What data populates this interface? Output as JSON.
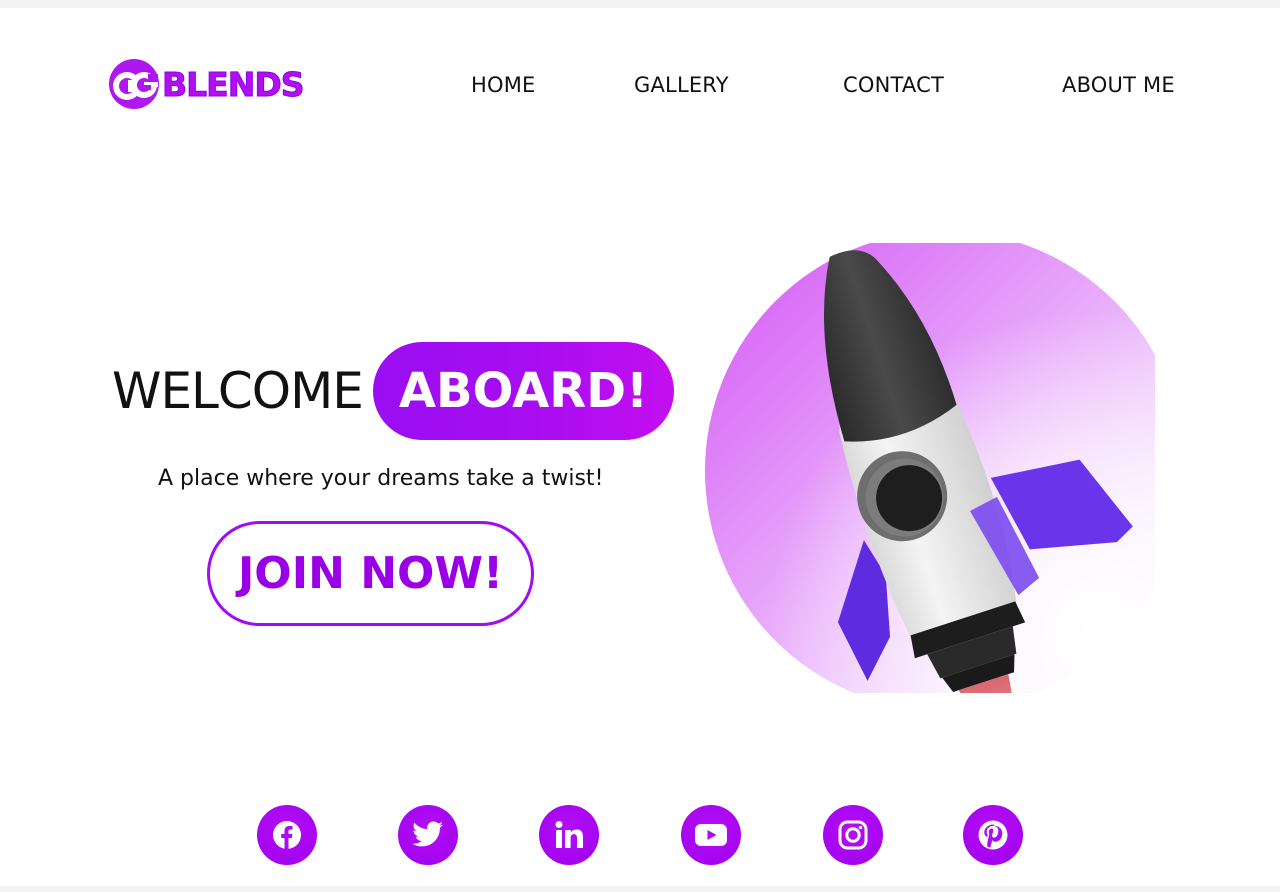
{
  "brand": {
    "badge_text": "CG",
    "name": "BLENDS",
    "color": "#a20ff0"
  },
  "nav": {
    "items": [
      {
        "label": "HOME"
      },
      {
        "label": "GALLERY"
      },
      {
        "label": "CONTACT"
      },
      {
        "label": "ABOUT ME"
      }
    ]
  },
  "hero": {
    "welcome": "WELCOME",
    "highlight": "ABOARD!",
    "tagline": "A place where your dreams take a twist!",
    "cta_label": "JOIN NOW!",
    "image": "rocket-illustration"
  },
  "socials": {
    "items": [
      {
        "name": "facebook-icon"
      },
      {
        "name": "twitter-icon"
      },
      {
        "name": "linkedin-icon"
      },
      {
        "name": "youtube-icon"
      },
      {
        "name": "instagram-icon"
      },
      {
        "name": "pinterest-icon"
      }
    ]
  },
  "colors": {
    "accent": "#a00df2",
    "accent_dark": "#8a00e6",
    "rocket_fin": "#6a2ee8",
    "rocket_nose": "#3a3a3a",
    "rocket_flame": "#e8787e"
  }
}
